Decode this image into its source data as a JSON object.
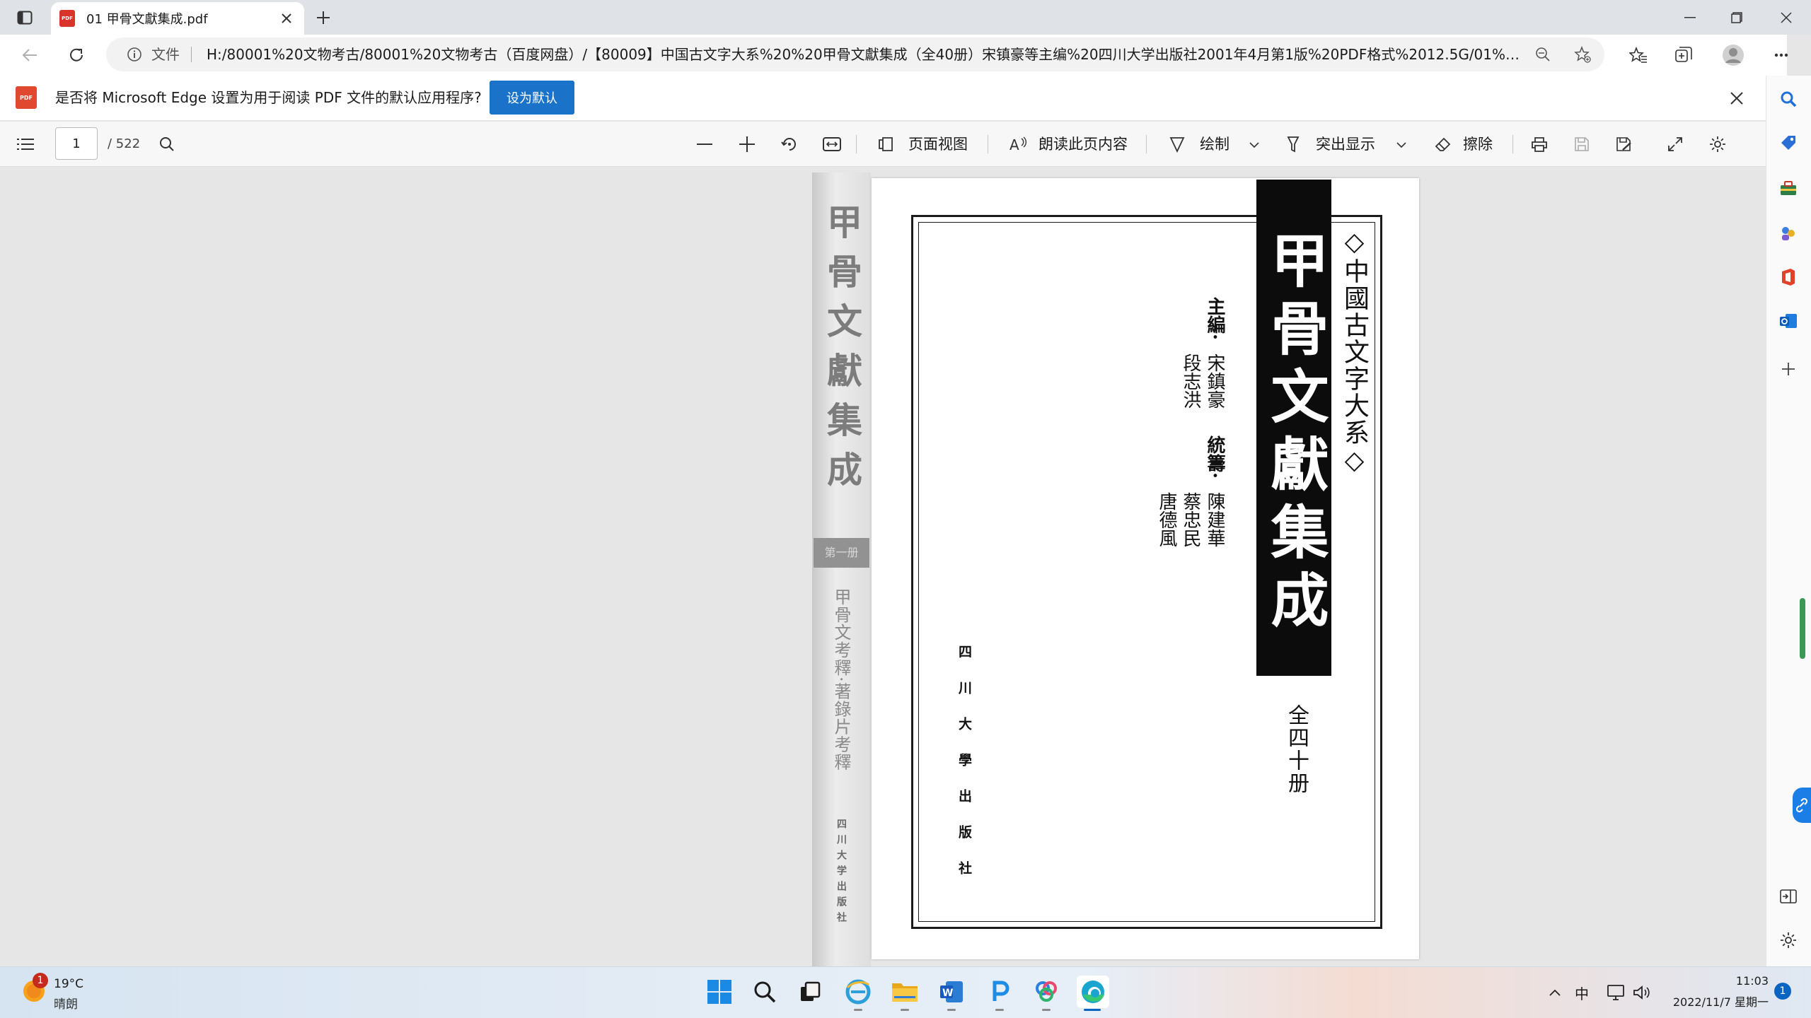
{
  "browser": {
    "tab_title": "01 甲骨文獻集成.pdf",
    "address_label": "文件",
    "address_url": "H:/80001%20文物考古/80001%20文物考古（百度网盘）/【80009】中国古文字大系%20%20甲骨文獻集成（全40册）宋镇豪等主编%20四川大学出版社2001年4月第1版%20PDF格式%2012.5G/01%20..."
  },
  "infobar": {
    "message": "是否将 Microsoft Edge 设置为用于阅读 PDF 文件的默认应用程序?",
    "set_default_label": "设为默认"
  },
  "pdf_toolbar": {
    "current_page": "1",
    "total_pages": "/ 522",
    "page_view_label": "页面视图",
    "read_aloud_label": "朗读此页内容",
    "draw_label": "绘制",
    "highlight_label": "突出显示",
    "erase_label": "擦除"
  },
  "document": {
    "spine_title": "甲骨文獻集成",
    "spine_volume": "第一册",
    "spine_subtitle": "甲骨文考釋·著錄片考釋",
    "spine_publisher": "四川大学出版社",
    "series": "◇中國古文字大系◇",
    "title": "甲骨文獻集成",
    "volumes": "全四十册",
    "editor_label": "主編·",
    "editor_1": "宋鎮豪",
    "editor_2": "段志洪",
    "coord_label": "統籌·",
    "coord_1": "陳建華",
    "coord_2": "蔡忠民",
    "coord_3": "唐德風",
    "publisher": "四川大學出版社"
  },
  "taskbar": {
    "temperature": "19°C",
    "weather": "晴朗",
    "weather_badge": "1",
    "ime": "中",
    "time": "11:03",
    "date": "2022/11/7 星期一",
    "notifications": "1"
  }
}
